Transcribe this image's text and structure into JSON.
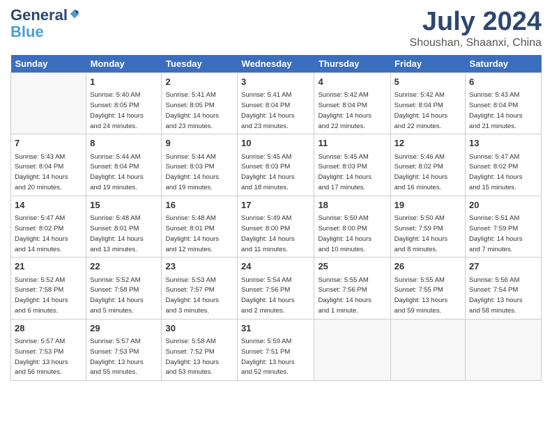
{
  "header": {
    "logo_general": "General",
    "logo_blue": "Blue",
    "title": "July 2024",
    "location": "Shoushan, Shaanxi, China"
  },
  "days_of_week": [
    "Sunday",
    "Monday",
    "Tuesday",
    "Wednesday",
    "Thursday",
    "Friday",
    "Saturday"
  ],
  "weeks": [
    [
      {
        "day": "",
        "info": ""
      },
      {
        "day": "1",
        "info": "Sunrise: 5:40 AM\nSunset: 8:05 PM\nDaylight: 14 hours\nand 24 minutes."
      },
      {
        "day": "2",
        "info": "Sunrise: 5:41 AM\nSunset: 8:05 PM\nDaylight: 14 hours\nand 23 minutes."
      },
      {
        "day": "3",
        "info": "Sunrise: 5:41 AM\nSunset: 8:04 PM\nDaylight: 14 hours\nand 23 minutes."
      },
      {
        "day": "4",
        "info": "Sunrise: 5:42 AM\nSunset: 8:04 PM\nDaylight: 14 hours\nand 22 minutes."
      },
      {
        "day": "5",
        "info": "Sunrise: 5:42 AM\nSunset: 8:04 PM\nDaylight: 14 hours\nand 22 minutes."
      },
      {
        "day": "6",
        "info": "Sunrise: 5:43 AM\nSunset: 8:04 PM\nDaylight: 14 hours\nand 21 minutes."
      }
    ],
    [
      {
        "day": "7",
        "info": "Sunrise: 5:43 AM\nSunset: 8:04 PM\nDaylight: 14 hours\nand 20 minutes."
      },
      {
        "day": "8",
        "info": "Sunrise: 5:44 AM\nSunset: 8:04 PM\nDaylight: 14 hours\nand 19 minutes."
      },
      {
        "day": "9",
        "info": "Sunrise: 5:44 AM\nSunset: 8:03 PM\nDaylight: 14 hours\nand 19 minutes."
      },
      {
        "day": "10",
        "info": "Sunrise: 5:45 AM\nSunset: 8:03 PM\nDaylight: 14 hours\nand 18 minutes."
      },
      {
        "day": "11",
        "info": "Sunrise: 5:45 AM\nSunset: 8:03 PM\nDaylight: 14 hours\nand 17 minutes."
      },
      {
        "day": "12",
        "info": "Sunrise: 5:46 AM\nSunset: 8:02 PM\nDaylight: 14 hours\nand 16 minutes."
      },
      {
        "day": "13",
        "info": "Sunrise: 5:47 AM\nSunset: 8:02 PM\nDaylight: 14 hours\nand 15 minutes."
      }
    ],
    [
      {
        "day": "14",
        "info": "Sunrise: 5:47 AM\nSunset: 8:02 PM\nDaylight: 14 hours\nand 14 minutes."
      },
      {
        "day": "15",
        "info": "Sunrise: 5:48 AM\nSunset: 8:01 PM\nDaylight: 14 hours\nand 13 minutes."
      },
      {
        "day": "16",
        "info": "Sunrise: 5:48 AM\nSunset: 8:01 PM\nDaylight: 14 hours\nand 12 minutes."
      },
      {
        "day": "17",
        "info": "Sunrise: 5:49 AM\nSunset: 8:00 PM\nDaylight: 14 hours\nand 11 minutes."
      },
      {
        "day": "18",
        "info": "Sunrise: 5:50 AM\nSunset: 8:00 PM\nDaylight: 14 hours\nand 10 minutes."
      },
      {
        "day": "19",
        "info": "Sunrise: 5:50 AM\nSunset: 7:59 PM\nDaylight: 14 hours\nand 8 minutes."
      },
      {
        "day": "20",
        "info": "Sunrise: 5:51 AM\nSunset: 7:59 PM\nDaylight: 14 hours\nand 7 minutes."
      }
    ],
    [
      {
        "day": "21",
        "info": "Sunrise: 5:52 AM\nSunset: 7:58 PM\nDaylight: 14 hours\nand 6 minutes."
      },
      {
        "day": "22",
        "info": "Sunrise: 5:52 AM\nSunset: 7:58 PM\nDaylight: 14 hours\nand 5 minutes."
      },
      {
        "day": "23",
        "info": "Sunrise: 5:53 AM\nSunset: 7:57 PM\nDaylight: 14 hours\nand 3 minutes."
      },
      {
        "day": "24",
        "info": "Sunrise: 5:54 AM\nSunset: 7:56 PM\nDaylight: 14 hours\nand 2 minutes."
      },
      {
        "day": "25",
        "info": "Sunrise: 5:55 AM\nSunset: 7:56 PM\nDaylight: 14 hours\nand 1 minute."
      },
      {
        "day": "26",
        "info": "Sunrise: 5:55 AM\nSunset: 7:55 PM\nDaylight: 13 hours\nand 59 minutes."
      },
      {
        "day": "27",
        "info": "Sunrise: 5:56 AM\nSunset: 7:54 PM\nDaylight: 13 hours\nand 58 minutes."
      }
    ],
    [
      {
        "day": "28",
        "info": "Sunrise: 5:57 AM\nSunset: 7:53 PM\nDaylight: 13 hours\nand 56 minutes."
      },
      {
        "day": "29",
        "info": "Sunrise: 5:57 AM\nSunset: 7:53 PM\nDaylight: 13 hours\nand 55 minutes."
      },
      {
        "day": "30",
        "info": "Sunrise: 5:58 AM\nSunset: 7:52 PM\nDaylight: 13 hours\nand 53 minutes."
      },
      {
        "day": "31",
        "info": "Sunrise: 5:59 AM\nSunset: 7:51 PM\nDaylight: 13 hours\nand 52 minutes."
      },
      {
        "day": "",
        "info": ""
      },
      {
        "day": "",
        "info": ""
      },
      {
        "day": "",
        "info": ""
      }
    ]
  ]
}
